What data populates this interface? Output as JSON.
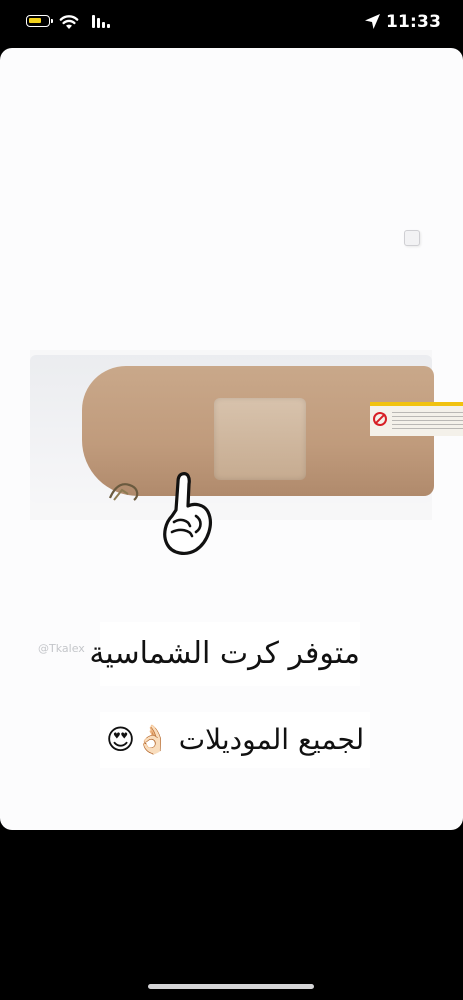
{
  "status_bar": {
    "time": "11:33",
    "icons": [
      "battery-icon",
      "wifi-icon",
      "signal-icon",
      "location-arrow-icon"
    ]
  },
  "story": {
    "watermark": "@Tkalex",
    "caption_line_1": "متوفر كرت الشماسية",
    "caption_line_2": "لجميع الموديلات 👌🏻😍",
    "pointing_emoji": "pointing-up-hand-icon"
  },
  "colors": {
    "background": "#000000",
    "card": "#fcfcfd",
    "battery_fill": "#f2d11b",
    "visor": "#c9a88a"
  }
}
